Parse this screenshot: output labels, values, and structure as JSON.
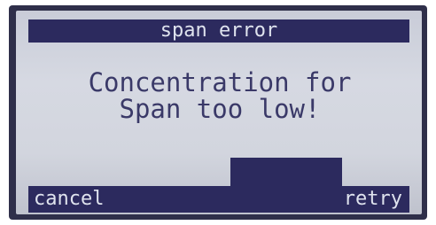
{
  "screen": {
    "title": "span error",
    "message_line1": "Concentration for",
    "message_line2": "Span too low!"
  },
  "softkeys": {
    "left_label": "cancel",
    "right_label": "retry"
  },
  "colors": {
    "lcd_background": "#d2d5de",
    "bar_fill": "#2c2a5e",
    "text_dark": "#3a3968",
    "text_light": "#dfe3ee"
  }
}
